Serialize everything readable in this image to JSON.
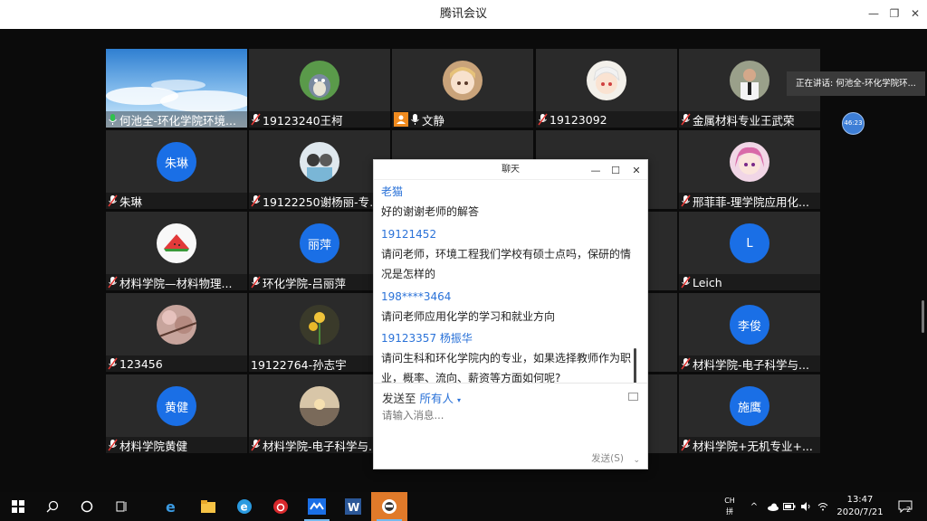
{
  "window": {
    "title": "腾讯会议",
    "minimize": "—",
    "restore": "❐",
    "close": "✕"
  },
  "speaking": {
    "text": "正在讲话: 何池全-环化学院环..."
  },
  "timer_badge": "46:23",
  "participants": [
    {
      "name": "何池全-环化学院环境...",
      "avatar": "sky-photo",
      "mic": "on"
    },
    {
      "name": "19123240王柯",
      "avatar": "totoro-photo",
      "mic": "off"
    },
    {
      "name": "文静",
      "avatar": "anime-girl-photo",
      "mic": "on",
      "host": true
    },
    {
      "name": "19123092",
      "avatar": "anime-boy-photo",
      "mic": "off"
    },
    {
      "name": "金属材料专业王武荣",
      "avatar": "person-photo",
      "mic": "off"
    },
    {
      "name": "朱琳",
      "avatar_text": "朱琳",
      "mic": "off"
    },
    {
      "name": "19122250谢杨丽-专业...",
      "avatar": "couple-photo",
      "mic": "off"
    },
    {
      "name": "邢菲菲-理学院应用化...",
      "avatar": "pink-hair-photo",
      "mic": "off"
    },
    {
      "name": "材料学院—材料物理...",
      "avatar": "watermelon-photo",
      "mic": "off"
    },
    {
      "name": "环化学院-吕丽萍",
      "avatar_text": "丽萍",
      "mic": "off"
    },
    {
      "name": "Leich",
      "avatar_text": "L",
      "mic": "off"
    },
    {
      "name": "123456",
      "avatar": "blossom-photo",
      "mic": "off"
    },
    {
      "name": "19122764-孙志宇",
      "avatar": "flower-photo",
      "mic": "none"
    },
    {
      "name": "材料学院-电子科学与...",
      "avatar_text": "李俊",
      "mic": "off"
    },
    {
      "name": "材料学院黄健",
      "avatar_text": "黄健",
      "mic": "off"
    },
    {
      "name": "材料学院-电子科学与...",
      "avatar": "sunset-photo",
      "mic": "off"
    },
    {
      "name": "材料学院+无机专业+...",
      "avatar_text": "施鹰",
      "mic": "off"
    }
  ],
  "chat": {
    "title": "聊天",
    "messages": [
      {
        "sender": "老猫",
        "lines": [
          "好的谢谢老师的解答"
        ]
      },
      {
        "sender": "19121452",
        "lines": [
          "请问老师，环境工程我们学校有硕士点吗，保研的情",
          "况是怎样的"
        ]
      },
      {
        "sender": "198****3464",
        "lines": [
          "请问老师应用化学的学习和就业方向"
        ]
      },
      {
        "sender": "19123357 杨振华",
        "lines": [
          "请问生科和环化学院内的专业，如果选择教师作为职",
          "业，概率、流向、薪资等方面如何呢?"
        ]
      }
    ],
    "send_to_label": "发送至",
    "send_to_target": "所有人",
    "input_placeholder": "请输入消息...",
    "send_button": "发送(S)"
  },
  "taskbar": {
    "apps": [
      "start-icon",
      "search-icon",
      "cortana-icon",
      "task-view-icon",
      "edge-icon",
      "file-explorer-icon",
      "ie-icon",
      "netease-music-icon",
      "tencent-meeting-icon",
      "word-icon",
      "wechat-icon"
    ],
    "ime_top": "CH",
    "ime_bottom": "拼",
    "time": "13:47",
    "date": "2020/7/21",
    "notification_count": "2"
  }
}
